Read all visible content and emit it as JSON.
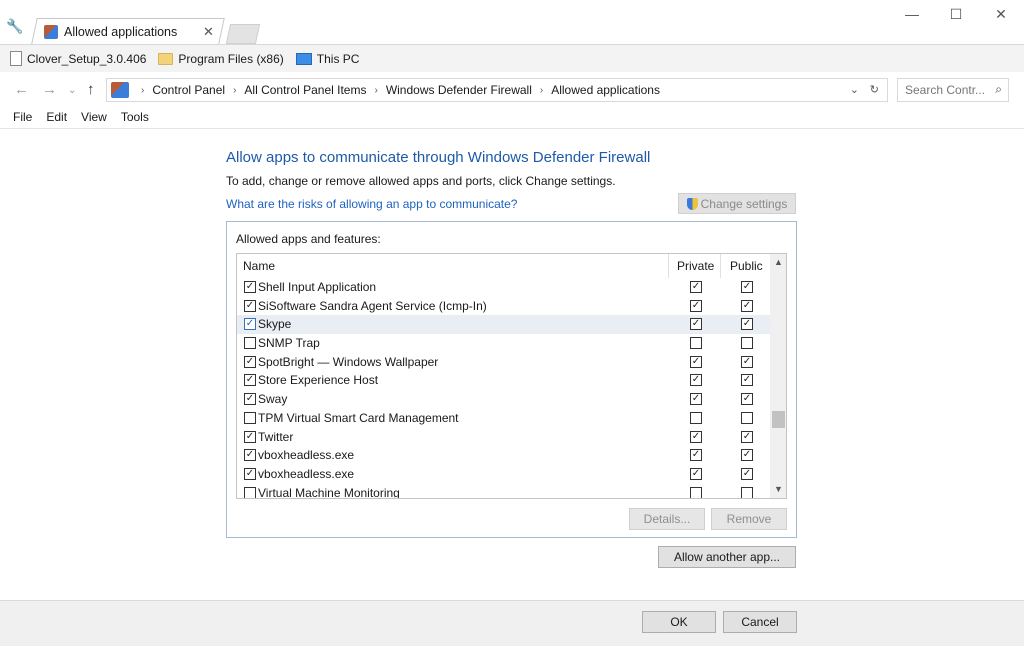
{
  "window": {
    "tab_title": "Allowed applications",
    "close_tab": "✕",
    "minimize": "—",
    "maximize": "☐",
    "close": "✕"
  },
  "favorites": [
    {
      "label": "Clover_Setup_3.0.406",
      "icon": "document-icon"
    },
    {
      "label": "Program Files (x86)",
      "icon": "folder-icon"
    },
    {
      "label": "This PC",
      "icon": "pc-icon"
    }
  ],
  "address": {
    "breadcrumbs": [
      "Control Panel",
      "All Control Panel Items",
      "Windows Defender Firewall",
      "Allowed applications"
    ],
    "search_placeholder": "Search Contr..."
  },
  "menu": [
    "File",
    "Edit",
    "View",
    "Tools"
  ],
  "main": {
    "heading": "Allow apps to communicate through Windows Defender Firewall",
    "subtext": "To add, change or remove allowed apps and ports, click Change settings.",
    "risk_link": "What are the risks of allowing an app to communicate?",
    "change_settings": "Change settings",
    "group_label": "Allowed apps and features:",
    "columns": {
      "name": "Name",
      "private": "Private",
      "public": "Public"
    },
    "apps": [
      {
        "name": "Shell Input Application",
        "enabled": true,
        "private": true,
        "public": true
      },
      {
        "name": "SiSoftware Sandra Agent Service (Icmp-In)",
        "enabled": true,
        "private": true,
        "public": true
      },
      {
        "name": "Skype",
        "enabled": true,
        "private": true,
        "public": true,
        "selected": true
      },
      {
        "name": "SNMP Trap",
        "enabled": false,
        "private": false,
        "public": false
      },
      {
        "name": "SpotBright — Windows Wallpaper",
        "enabled": true,
        "private": true,
        "public": true
      },
      {
        "name": "Store Experience Host",
        "enabled": true,
        "private": true,
        "public": true
      },
      {
        "name": "Sway",
        "enabled": true,
        "private": true,
        "public": true
      },
      {
        "name": "TPM Virtual Smart Card Management",
        "enabled": false,
        "private": false,
        "public": false
      },
      {
        "name": "Twitter",
        "enabled": true,
        "private": true,
        "public": true
      },
      {
        "name": "vboxheadless.exe",
        "enabled": true,
        "private": true,
        "public": true
      },
      {
        "name": "vboxheadless.exe",
        "enabled": true,
        "private": true,
        "public": true
      },
      {
        "name": "Virtual Machine Monitoring",
        "enabled": false,
        "private": false,
        "public": false
      }
    ],
    "details_button": "Details...",
    "remove_button": "Remove",
    "allow_another_button": "Allow another app..."
  },
  "footer": {
    "ok": "OK",
    "cancel": "Cancel"
  },
  "colors": {
    "heading": "#1e5aa8",
    "link": "#1e62c0",
    "selected_row": "#e9eef4"
  }
}
